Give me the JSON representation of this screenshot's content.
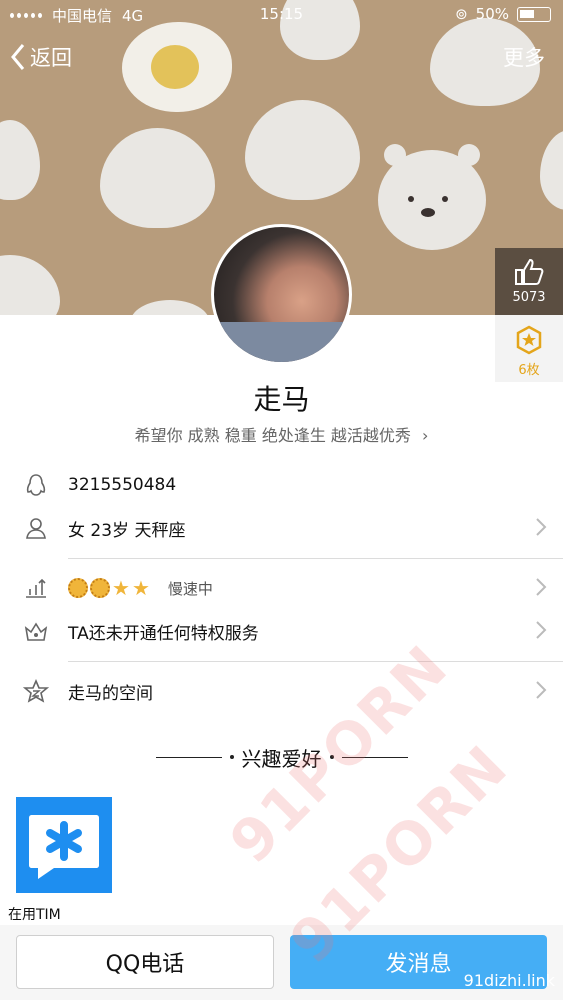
{
  "status": {
    "carrier": "中国电信",
    "network": "4G",
    "time": "15:15",
    "battery": "50%"
  },
  "nav": {
    "back_label": "返回",
    "more_label": "更多"
  },
  "likes": {
    "count": "5073"
  },
  "medals": {
    "count": "6枚"
  },
  "profile": {
    "name": "走马",
    "signature": "希望你 成熟 稳重 绝处逢生 越活越优秀"
  },
  "info": {
    "qq_number": "3215550484",
    "basic": "女 23岁 天秤座",
    "level_speed": "慢速中",
    "privilege": "TA还未开通任何特权服务",
    "space": "走马的空间"
  },
  "interests": {
    "title": "兴趣爱好",
    "app_label": "在用TIM"
  },
  "actions": {
    "call_label": "QQ电话",
    "message_label": "发消息"
  },
  "watermark": {
    "text": "91PORN",
    "url": "91dizhi.link"
  },
  "colors": {
    "banner": "#b79c7c",
    "accent": "#45aef5",
    "tim": "#1e8ef0",
    "like_box": "#5b4e41"
  }
}
